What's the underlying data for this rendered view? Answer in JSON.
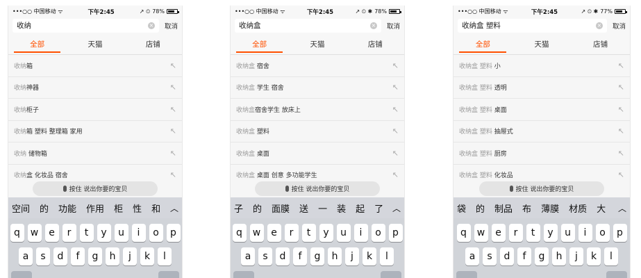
{
  "keyboard_rows": [
    [
      "q",
      "w",
      "e",
      "r",
      "t",
      "y",
      "u",
      "i",
      "o",
      "p"
    ],
    [
      "a",
      "s",
      "d",
      "f",
      "g",
      "h",
      "j",
      "k",
      "l"
    ]
  ],
  "screens": [
    {
      "status": {
        "carrier": "•••○○ 中国移动 ᯤ",
        "time": "下午2:45",
        "indicators": "↗ ⏲",
        "battery": "78%",
        "battery_level": 0.78
      },
      "search": {
        "query": "收纳",
        "cancel": "取消"
      },
      "tabs": [
        {
          "label": "全部",
          "active": true
        },
        {
          "label": "天猫",
          "active": false
        },
        {
          "label": "店铺",
          "active": false
        }
      ],
      "suggestions": [
        {
          "prefix": "收纳",
          "suffix": "箱"
        },
        {
          "prefix": "收纳",
          "suffix": "神器"
        },
        {
          "prefix": "收纳",
          "suffix": "柜子"
        },
        {
          "prefix": "收纳",
          "suffix": "箱 塑料 整理箱 家用"
        },
        {
          "prefix": "收纳",
          "suffix": " 储物箱"
        },
        {
          "prefix": "收纳",
          "suffix": "盒 化妆品 宿舍"
        }
      ],
      "voice_label": "按住 说出你要的宝贝",
      "candidates": [
        "空间",
        "的",
        "功能",
        "作用",
        "柜",
        "性",
        "和"
      ]
    },
    {
      "status": {
        "carrier": "•••○○ 中国移动 ᯤ",
        "time": "下午2:45",
        "indicators": "↗ ⏲ ✱",
        "battery": "78%",
        "battery_level": 0.78
      },
      "search": {
        "query": "收纳盒",
        "cancel": "取消"
      },
      "tabs": [
        {
          "label": "全部",
          "active": true
        },
        {
          "label": "天猫",
          "active": false
        },
        {
          "label": "店铺",
          "active": false
        }
      ],
      "suggestions": [
        {
          "prefix": "收纳盒",
          "suffix": " 宿舍"
        },
        {
          "prefix": "收纳盒",
          "suffix": " 学生 宿舍"
        },
        {
          "prefix": "收纳盒",
          "suffix": "宿舍学生 放床上"
        },
        {
          "prefix": "收纳盒",
          "suffix": " 塑料"
        },
        {
          "prefix": "收纳盒",
          "suffix": " 桌面"
        },
        {
          "prefix": "收纳盒",
          "suffix": " 桌面 创意 多功能学生"
        }
      ],
      "voice_label": "按住 说出你要的宝贝",
      "candidates": [
        "子",
        "的",
        "面膜",
        "送",
        "一",
        "装",
        "起",
        "了"
      ]
    },
    {
      "status": {
        "carrier": "•••○○ 中国移动 ᯤ",
        "time": "下午2:45",
        "indicators": "↗ ⏲ ✱",
        "battery": "77%",
        "battery_level": 0.77
      },
      "search": {
        "query": "收纳盒 塑料",
        "cancel": "取消"
      },
      "tabs": [
        {
          "label": "全部",
          "active": true
        },
        {
          "label": "天猫",
          "active": false
        },
        {
          "label": "店铺",
          "active": false
        }
      ],
      "suggestions": [
        {
          "prefix": "收纳盒 塑料",
          "suffix": " 小"
        },
        {
          "prefix": "收纳盒 塑料",
          "suffix": " 透明"
        },
        {
          "prefix": "收纳盒 塑料",
          "suffix": " 桌面"
        },
        {
          "prefix": "收纳盒 塑料",
          "suffix": " 抽屉式"
        },
        {
          "prefix": "收纳盒 塑料",
          "suffix": " 厨房"
        },
        {
          "prefix": "收纳盒 塑料",
          "suffix": " 化妆品"
        }
      ],
      "voice_label": "按住 说出你要的宝贝",
      "candidates": [
        "袋",
        "的",
        "制品",
        "布",
        "薄膜",
        "材质",
        "大"
      ]
    }
  ]
}
